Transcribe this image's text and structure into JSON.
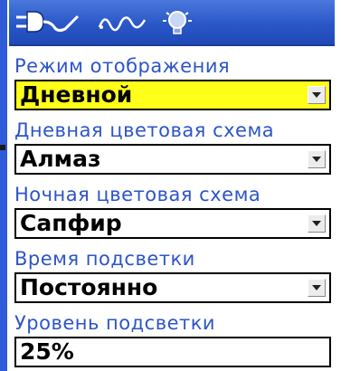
{
  "header": {
    "tab_icons": [
      "backlight-plug-icon",
      "signal-wave-icon",
      "lightbulb-icon"
    ],
    "colors": {
      "header_blue": "#2a57c8",
      "label_blue": "#2d55c9",
      "highlight_yellow": "#ffff1a"
    }
  },
  "settings": [
    {
      "label": "Режим отображения",
      "value": "Дневной",
      "selected": true,
      "has_dropdown": true
    },
    {
      "label": "Дневная цветовая схема",
      "value": "Алмаз",
      "selected": false,
      "has_dropdown": true
    },
    {
      "label": "Ночная цветовая схема",
      "value": "Сапфир",
      "selected": false,
      "has_dropdown": true
    },
    {
      "label": "Время подсветки",
      "value": "Постоянно",
      "selected": false,
      "has_dropdown": true
    },
    {
      "label": "Уровень подсветки",
      "value": "25%",
      "selected": false,
      "has_dropdown": false
    }
  ]
}
